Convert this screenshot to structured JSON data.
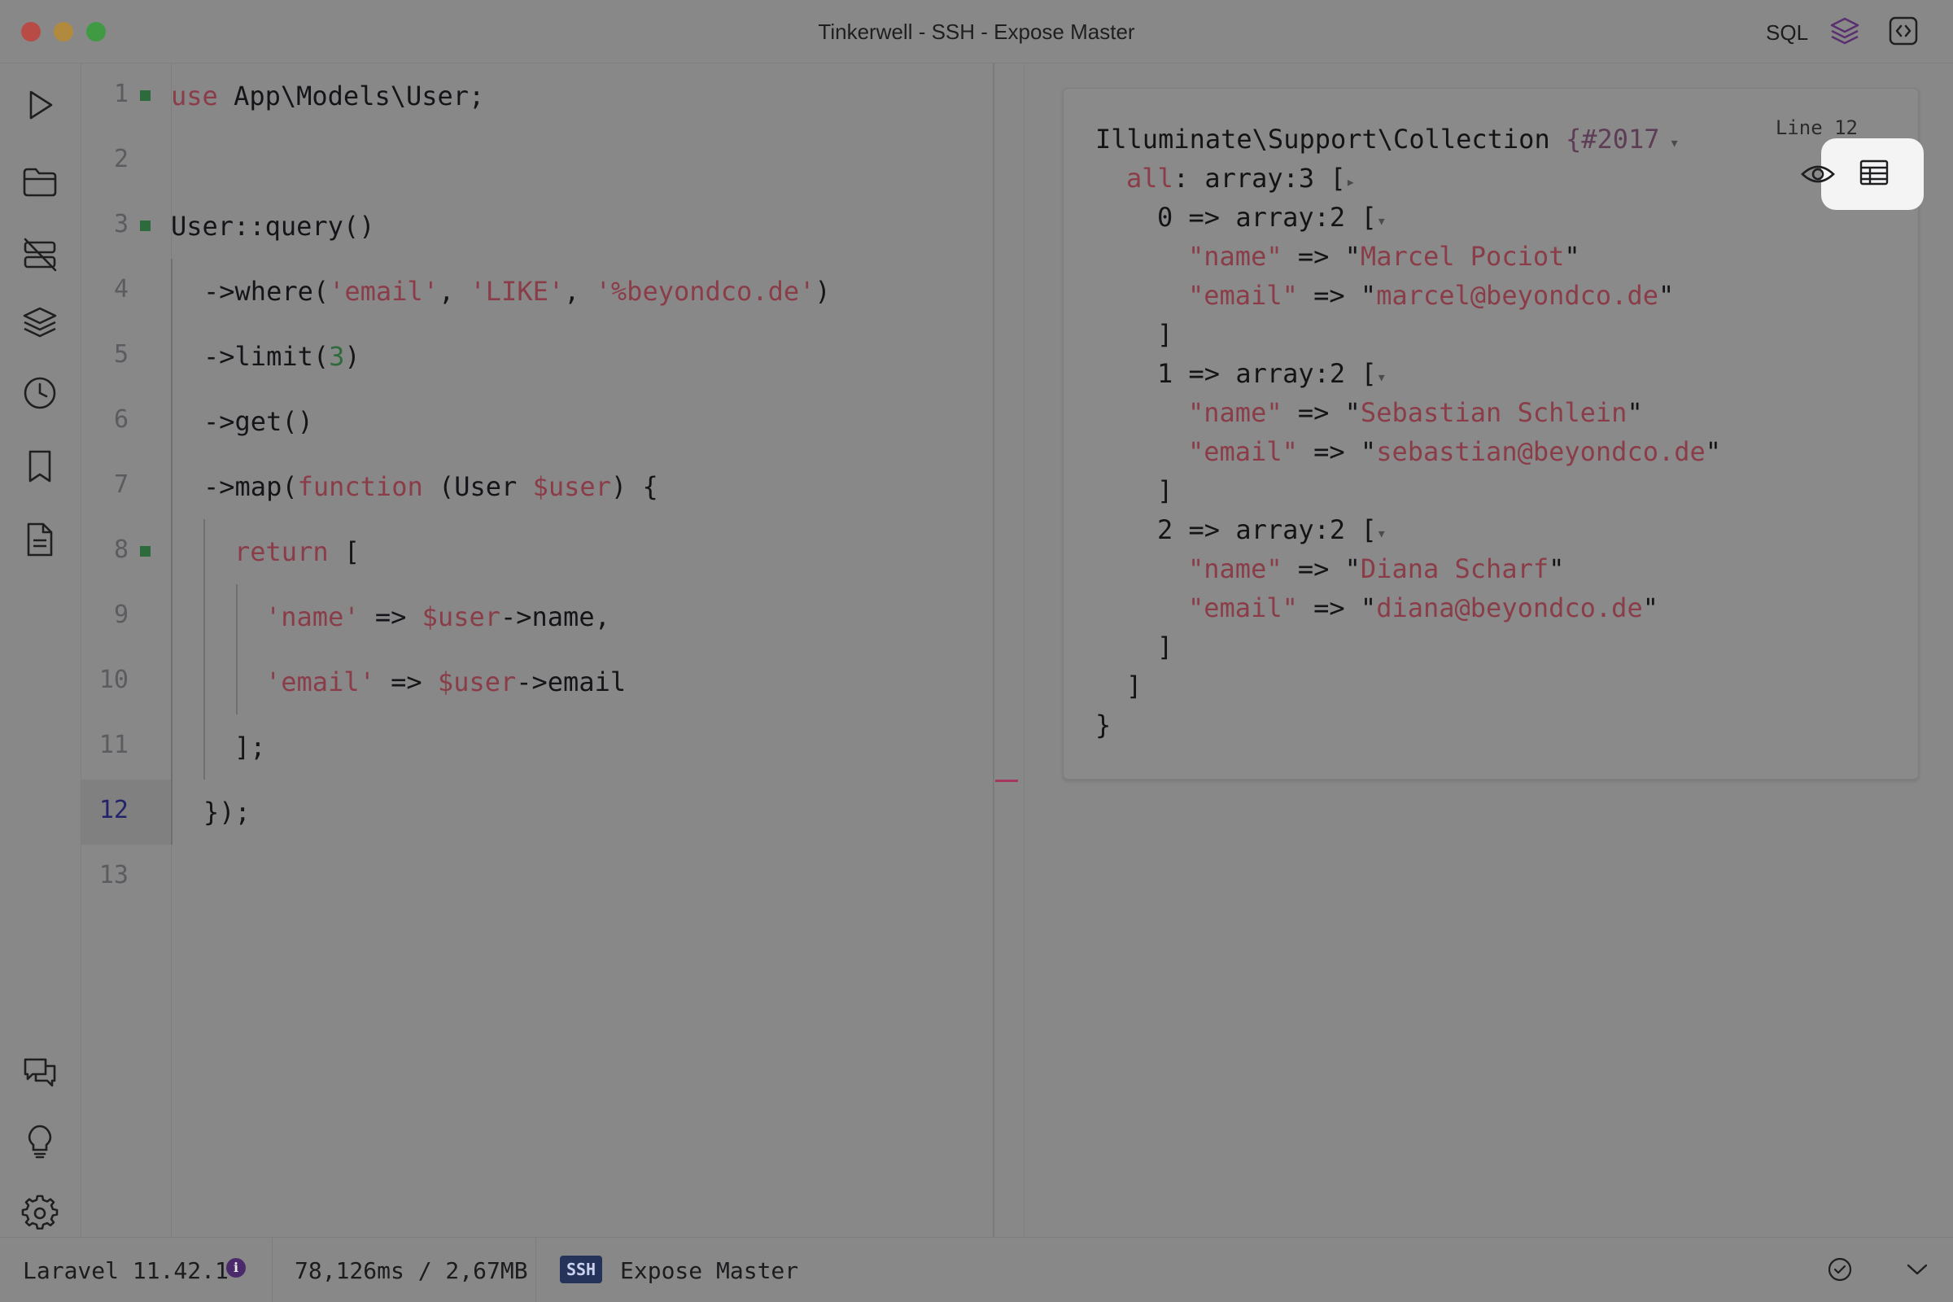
{
  "window": {
    "title": "Tinkerwell - SSH - Expose Master",
    "sql_label": "SQL"
  },
  "sidebar": {
    "items": [
      {
        "icon": "play-icon"
      },
      {
        "icon": "folder-icon"
      },
      {
        "icon": "database-off-icon"
      },
      {
        "icon": "layers-icon"
      },
      {
        "icon": "clock-icon"
      },
      {
        "icon": "bookmark-icon"
      },
      {
        "icon": "document-icon"
      },
      {
        "icon": "chat-icon"
      },
      {
        "icon": "lightbulb-icon"
      },
      {
        "icon": "gear-icon"
      }
    ]
  },
  "editor": {
    "active_line": 12,
    "line_numbers": [
      "1",
      "2",
      "3",
      "4",
      "5",
      "6",
      "7",
      "8",
      "9",
      "10",
      "11",
      "12",
      "13"
    ],
    "lines": {
      "l1": {
        "kw": "use",
        "rest": " App\\Models\\User;"
      },
      "l3": {
        "text": "User::query()"
      },
      "l4": {
        "a": "->where(",
        "s1": "'email'",
        "c1": ", ",
        "s2": "'LIKE'",
        "c2": ", ",
        "s3": "'%beyondco.de'",
        "e": ")"
      },
      "l5": {
        "a": "->limit(",
        "n": "3",
        "e": ")"
      },
      "l6": {
        "text": "->get()"
      },
      "l7": {
        "a": "->map(",
        "kw": "function",
        "b": " (User ",
        "v": "$user",
        "e": ") {"
      },
      "l8": {
        "kw": "return",
        "e": " ["
      },
      "l9": {
        "s": "'name'",
        "a": " => ",
        "v": "$user",
        "e": "->name,"
      },
      "l10": {
        "s": "'email'",
        "a": " => ",
        "v": "$user",
        "e": "->email"
      },
      "l11": {
        "text": "];"
      },
      "l12": {
        "text": "});"
      }
    }
  },
  "result": {
    "line_indicator": "Line 12",
    "class_name": "Illuminate\\Support\\Collection ",
    "ref": "{#2017",
    "all_key": "all",
    "all_type": ": array:3 [",
    "items": [
      {
        "index": "0 => array:2 [",
        "name": "Marcel Pociot",
        "email": "marcel@beyondco.de"
      },
      {
        "index": "1 => array:2 [",
        "name": "Sebastian Schlein",
        "email": "sebastian@beyondco.de"
      },
      {
        "index": "2 => array:2 [",
        "name": "Diana Scharf",
        "email": "diana@beyondco.de"
      }
    ],
    "name_key": "\"name\"",
    "email_key": "\"email\"",
    "arrow": " => ",
    "quote": "\"",
    "close_bracket": "]",
    "close_brace": "}"
  },
  "statusbar": {
    "framework": "Laravel 11.42.1",
    "info_glyph": "i",
    "metrics": "78,126ms / 2,67MB",
    "ssh_badge": "SSH",
    "connection": "Expose Master"
  }
}
